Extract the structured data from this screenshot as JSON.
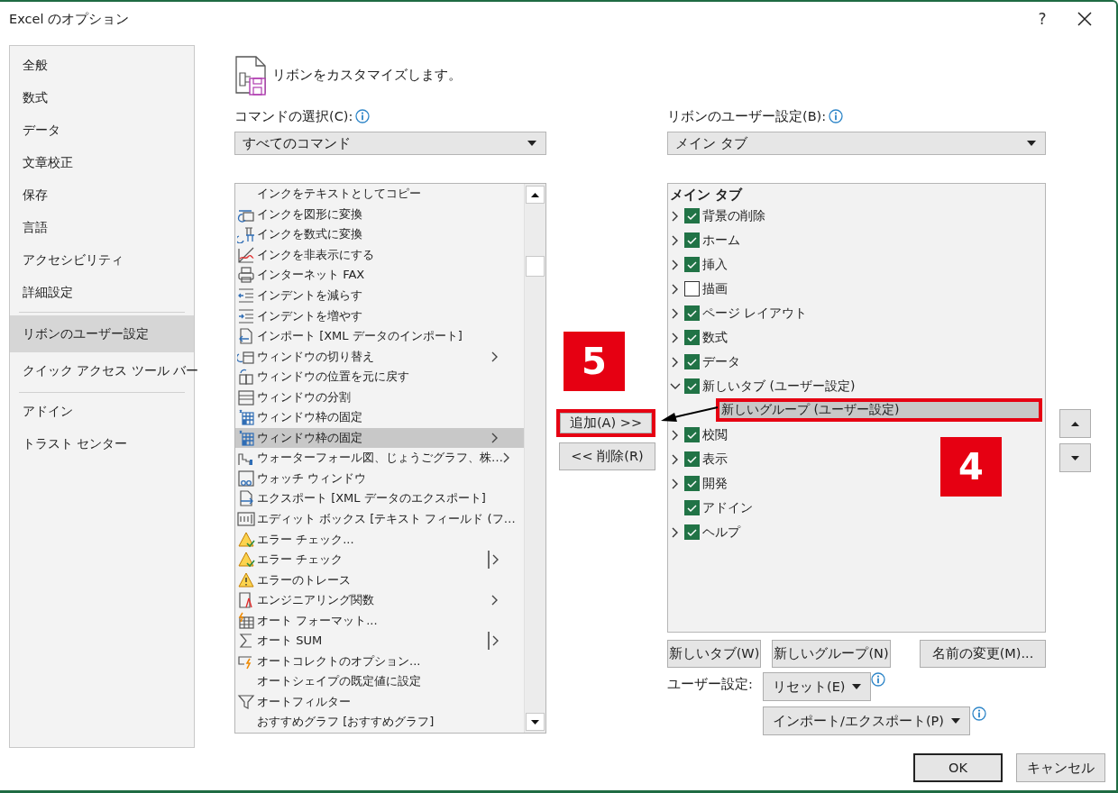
{
  "window": {
    "title": "Excel のオプション",
    "help_label": "?"
  },
  "sidebar": {
    "groups": [
      [
        {
          "label": "全般",
          "selected": false
        },
        {
          "label": "数式",
          "selected": false
        },
        {
          "label": "データ",
          "selected": false
        },
        {
          "label": "文章校正",
          "selected": false
        },
        {
          "label": "保存",
          "selected": false
        },
        {
          "label": "言語",
          "selected": false
        },
        {
          "label": "アクセシビリティ",
          "selected": false
        },
        {
          "label": "詳細設定",
          "selected": false
        }
      ],
      [
        {
          "label": "リボンのユーザー設定",
          "selected": true
        },
        {
          "label": "クイック アクセス ツール バー",
          "selected": false
        }
      ],
      [
        {
          "label": "アドイン",
          "selected": false
        },
        {
          "label": "トラスト センター",
          "selected": false
        }
      ]
    ]
  },
  "heading": "リボンをカスタマイズします。",
  "commands": {
    "label": "コマンドの選択(C):",
    "dropdown": "すべてのコマンド",
    "items": [
      {
        "label": "インクをテキストとしてコピー",
        "selected": false
      },
      {
        "label": "インクを図形に変換",
        "selected": false
      },
      {
        "label": "インクを数式に変換",
        "selected": false
      },
      {
        "label": "インクを非表示にする",
        "selected": false
      },
      {
        "label": "インターネット FAX",
        "selected": false
      },
      {
        "label": "インデントを減らす",
        "selected": false
      },
      {
        "label": "インデントを増やす",
        "selected": false
      },
      {
        "label": "インポート [XML データのインポート]",
        "selected": false
      },
      {
        "label": "ウィンドウの切り替え",
        "selected": false,
        "kind": "submenu"
      },
      {
        "label": "ウィンドウの位置を元に戻す",
        "selected": false
      },
      {
        "label": "ウィンドウの分割",
        "selected": false
      },
      {
        "label": "ウィンドウ枠の固定",
        "selected": false
      },
      {
        "label": "ウィンドウ枠の固定",
        "selected": true,
        "kind": "submenu"
      },
      {
        "label": "ウォーターフォール図、じょうごグラフ、株…",
        "selected": false,
        "kind": "submenu"
      },
      {
        "label": "ウォッチ ウィンドウ",
        "selected": false
      },
      {
        "label": "エクスポート [XML データのエクスポート]",
        "selected": false
      },
      {
        "label": "エディット ボックス [テキスト フィールド (フ…",
        "selected": false
      },
      {
        "label": "エラー チェック...",
        "selected": false
      },
      {
        "label": "エラー チェック",
        "selected": false,
        "kind": "split"
      },
      {
        "label": "エラーのトレース",
        "selected": false
      },
      {
        "label": "エンジニアリング関数",
        "selected": false,
        "kind": "submenu"
      },
      {
        "label": "オート フォーマット...",
        "selected": false
      },
      {
        "label": "オート SUM",
        "selected": false,
        "kind": "split"
      },
      {
        "label": "オートコレクトのオプション...",
        "selected": false
      },
      {
        "label": "オートシェイプの既定値に設定",
        "selected": false
      },
      {
        "label": "オートフィルター",
        "selected": false
      },
      {
        "label": "おすすめグラフ [おすすめグラフ]",
        "selected": false
      }
    ]
  },
  "transfer": {
    "add": {
      "label": "追加(A) >>",
      "highlighted": true
    },
    "remove": {
      "label": "<< 削除(R)"
    }
  },
  "ribbon": {
    "label": "リボンのユーザー設定(B):",
    "dropdown": "メイン タブ",
    "tree": {
      "header": "メイン タブ",
      "items": [
        {
          "kind": "tab",
          "label": "背景の削除",
          "expanded": false,
          "checked": true,
          "selected": false
        },
        {
          "kind": "tab",
          "label": "ホーム",
          "expanded": false,
          "checked": true,
          "selected": false
        },
        {
          "kind": "tab",
          "label": "挿入",
          "expanded": false,
          "checked": true,
          "selected": false
        },
        {
          "kind": "tab",
          "label": "描画",
          "expanded": false,
          "checked": false,
          "selected": false
        },
        {
          "kind": "tab",
          "label": "ページ レイアウト",
          "expanded": false,
          "checked": true,
          "selected": false
        },
        {
          "kind": "tab",
          "label": "数式",
          "expanded": false,
          "checked": true,
          "selected": false
        },
        {
          "kind": "tab",
          "label": "データ",
          "expanded": false,
          "checked": true,
          "selected": false
        },
        {
          "kind": "tab",
          "label": "新しいタブ (ユーザー設定)",
          "expanded": true,
          "checked": true,
          "selected": false,
          "children": [
            {
              "kind": "group",
              "label": "新しいグループ (ユーザー設定)",
              "selected": true,
              "highlighted": true
            }
          ]
        },
        {
          "kind": "tab",
          "label": "校閲",
          "expanded": false,
          "checked": true,
          "selected": false
        },
        {
          "kind": "tab",
          "label": "表示",
          "expanded": false,
          "checked": true,
          "selected": false
        },
        {
          "kind": "tab",
          "label": "開発",
          "expanded": false,
          "checked": true,
          "selected": false
        },
        {
          "kind": "leaf",
          "label": "アドイン",
          "checked": true,
          "selected": false
        },
        {
          "kind": "tab",
          "label": "ヘルプ",
          "expanded": false,
          "checked": true,
          "selected": false
        }
      ]
    },
    "buttons": [
      "新しいタブ(W)",
      "新しいグループ(N)",
      "名前の変更(M)..."
    ],
    "user_settings_label": "ユーザー設定:",
    "reset": "リセット(E)",
    "import_export": "インポート/エクスポート(P)"
  },
  "footer": {
    "ok": "OK",
    "cancel": "キャンセル"
  },
  "annotations": [
    {
      "label": "5"
    },
    {
      "label": "4"
    }
  ]
}
